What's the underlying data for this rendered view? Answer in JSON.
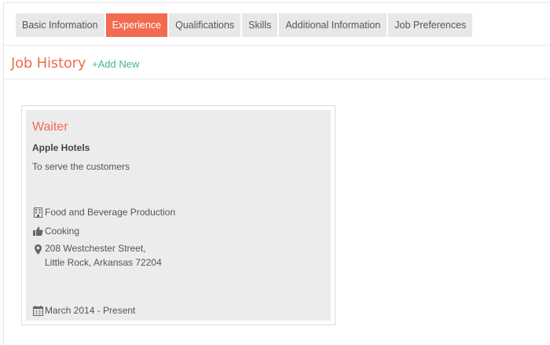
{
  "tabs": [
    {
      "label": "Basic Information",
      "active": false
    },
    {
      "label": "Experience",
      "active": true
    },
    {
      "label": "Qualifications",
      "active": false
    },
    {
      "label": "Skills",
      "active": false
    },
    {
      "label": "Additional Information",
      "active": false
    },
    {
      "label": "Job Preferences",
      "active": false
    }
  ],
  "section": {
    "title": "Job History",
    "add_new_label": "+Add New"
  },
  "job": {
    "title": "Waiter",
    "company": "Apple Hotels",
    "description": "To serve the customers",
    "industry": "Food and Beverage Production",
    "skill": "Cooking",
    "address_line1": "208 Westchester Street,",
    "address_line2": "Little Rock, Arkansas 72204",
    "date_range": "March 2014 -  Present",
    "icons": {
      "industry": "building-icon",
      "skill": "thumbs-up-icon",
      "address": "map-marker-icon",
      "date": "calendar-icon"
    }
  },
  "colors": {
    "accent": "#f26b50",
    "link": "#3bb7a0",
    "tab_bg": "#e8e8e8",
    "card_bg": "#ececec"
  }
}
